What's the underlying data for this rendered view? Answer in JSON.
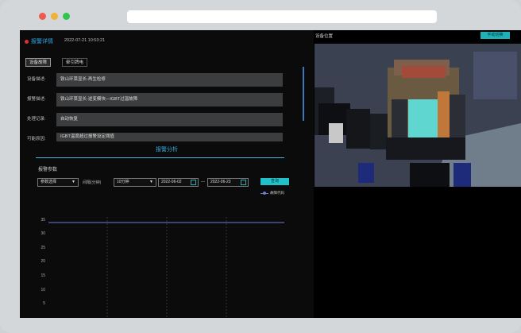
{
  "header": {
    "title": "报警详情",
    "time": "2022-07-21 10:53:21"
  },
  "tabs": [
    {
      "label": "设备故障"
    },
    {
      "label": "牵引牌电"
    }
  ],
  "fields": [
    {
      "label": "设备描述:",
      "value": "铁山环菜显长-再生检修"
    },
    {
      "label": "报警描述:",
      "value": "铁山环菜显长-逆变模块—IGBT过温故障"
    },
    {
      "label": "处理记录:",
      "value": "自动恢复"
    },
    {
      "label": "可能原因:",
      "value": "IGBT温度超过报警设定阈值"
    }
  ],
  "analysis": {
    "title": "报警分析",
    "params_title": "报警参数"
  },
  "filters": {
    "param_select": "参数选择",
    "interval_label": "间隔(分钟)",
    "interval_value": "10分钟",
    "start_date": "2022-06-02",
    "separator": "—",
    "end_date": "2022-06-23",
    "query_label": "查询"
  },
  "device_panel": {
    "title": "设备位置",
    "manual_label": "手动切换"
  },
  "chart_data": {
    "type": "line",
    "yticks": [
      "35",
      "30",
      "25",
      "20",
      "15",
      "10",
      "5"
    ],
    "ylim": [
      0,
      36
    ],
    "series": [
      {
        "name": "故障代码",
        "values": [
          34,
          34,
          34,
          34,
          34,
          34
        ],
        "color": "#6c7bd8"
      }
    ],
    "grid": true,
    "legend": "top-right"
  }
}
